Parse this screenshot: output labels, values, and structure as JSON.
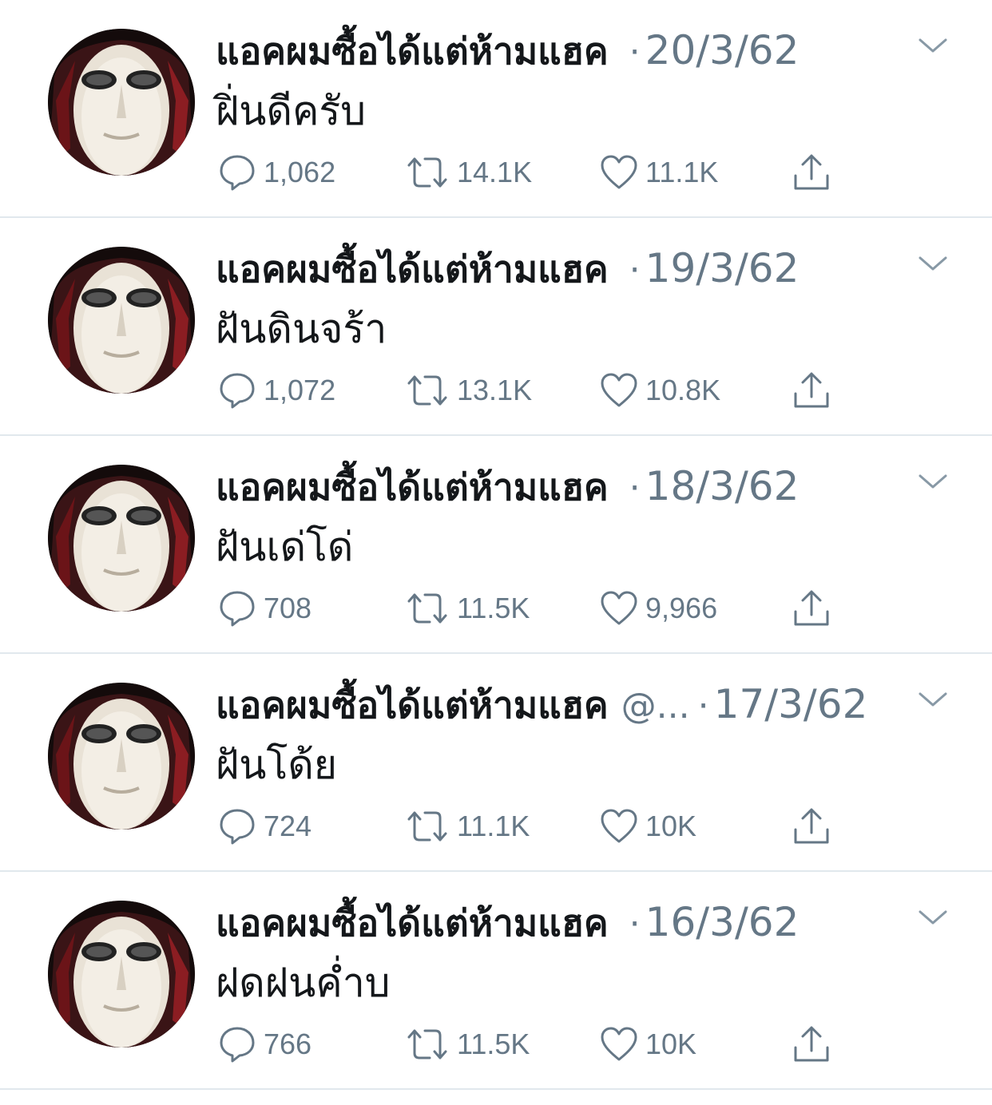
{
  "colors": {
    "text_primary": "#14171a",
    "text_secondary": "#657786",
    "divider": "#e1e8ed",
    "background": "#ffffff"
  },
  "icons": {
    "reply": "speech-bubble-icon",
    "retweet": "retweet-arrows-icon",
    "like": "heart-outline-icon",
    "share": "share-upload-icon",
    "menu": "chevron-down-icon"
  },
  "tweets": [
    {
      "display_name": "แอคผมซื้อได้แต่ห้ามแฮค",
      "handle": "",
      "separator": "·",
      "date": "20/3/62",
      "text": "ฝิ่นดีครับ",
      "replies": "1,062",
      "retweets": "14.1K",
      "likes": "11.1K"
    },
    {
      "display_name": "แอคผมซื้อได้แต่ห้ามแฮค",
      "handle": "",
      "separator": "·",
      "date": "19/3/62",
      "text": "ฝันดินจร้า",
      "replies": "1,072",
      "retweets": "13.1K",
      "likes": "10.8K"
    },
    {
      "display_name": "แอคผมซื้อได้แต่ห้ามแฮค",
      "handle": "",
      "separator": "·",
      "date": "18/3/62",
      "text": "ฝันเด่โด่",
      "replies": "708",
      "retweets": "11.5K",
      "likes": "9,966"
    },
    {
      "display_name": "แอคผมซื้อได้แต่ห้ามแฮค",
      "handle": "@...",
      "separator": "·",
      "date": "17/3/62",
      "text": "ฝันโด้ย",
      "replies": "724",
      "retweets": "11.1K",
      "likes": "10K"
    },
    {
      "display_name": "แอคผมซื้อได้แต่ห้ามแฮค",
      "handle": "",
      "separator": "·",
      "date": "16/3/62",
      "text": "ฝดฝนค่ำบ",
      "replies": "766",
      "retweets": "11.5K",
      "likes": "10K"
    }
  ]
}
